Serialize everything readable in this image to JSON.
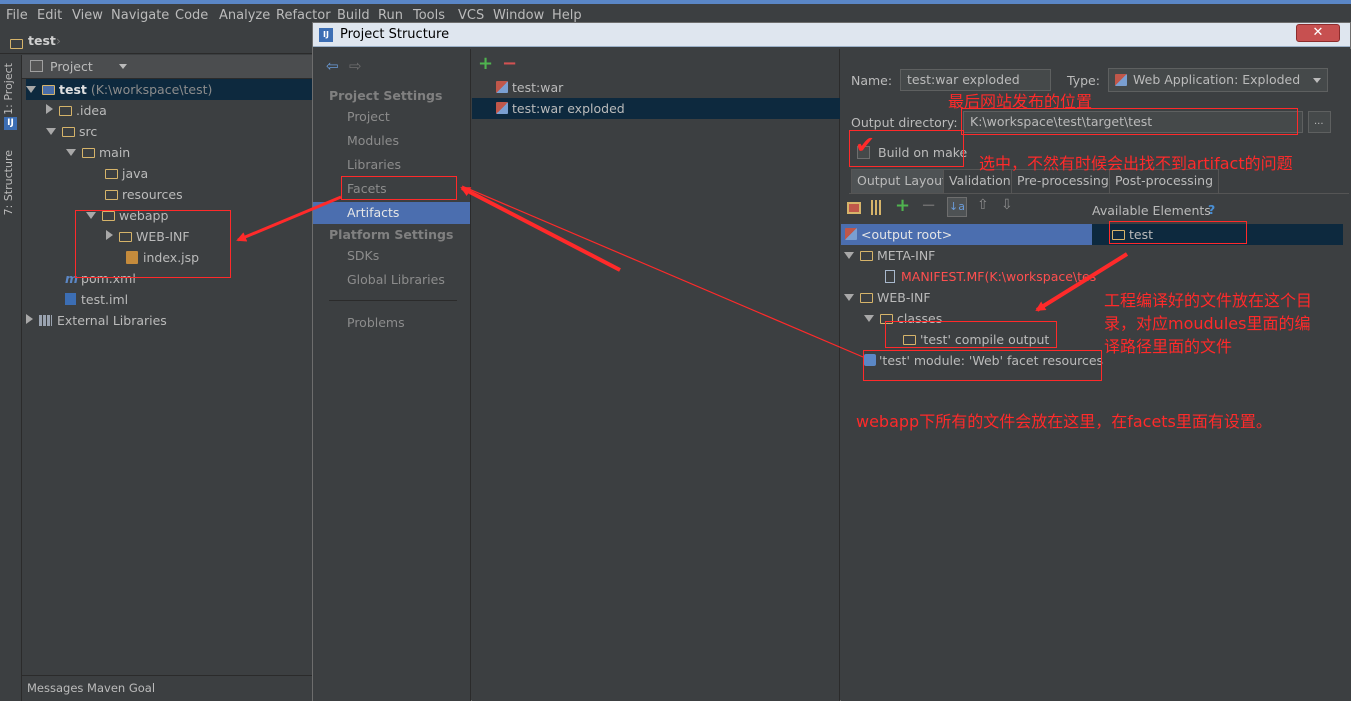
{
  "menubar": {
    "items": [
      "File",
      "Edit",
      "View",
      "Navigate",
      "Code",
      "Analyze",
      "Refactor",
      "Build",
      "Run",
      "Tools",
      "VCS",
      "Window",
      "Help"
    ]
  },
  "navbar": {
    "breadcrumb": "test"
  },
  "toolstrip": {
    "tab_project": "1: Project",
    "tab_structure": "7: Structure"
  },
  "project_panel": {
    "view_selector": "Project",
    "tree": [
      {
        "label": "test",
        "hint": "(K:\\workspace\\test)"
      },
      {
        "label": ".idea"
      },
      {
        "label": "src"
      },
      {
        "label": "main"
      },
      {
        "label": "java"
      },
      {
        "label": "resources"
      },
      {
        "label": "webapp"
      },
      {
        "label": "WEB-INF"
      },
      {
        "label": "index.jsp"
      },
      {
        "label": "pom.xml"
      },
      {
        "label": "test.iml"
      },
      {
        "label": "External Libraries"
      }
    ],
    "bottom_bar": "Messages Maven Goal"
  },
  "dialog": {
    "title": "Project Structure",
    "close": "✕",
    "nav": {
      "project_settings_heading": "Project Settings",
      "project_settings": [
        "Project",
        "Modules",
        "Libraries",
        "Facets",
        "Artifacts"
      ],
      "platform_settings_heading": "Platform Settings",
      "platform_settings": [
        "SDKs",
        "Global Libraries"
      ],
      "problems": "Problems",
      "selected": "Artifacts"
    },
    "artifacts": [
      "test:war",
      "test:war exploded"
    ],
    "selected_artifact": "test:war exploded",
    "detail": {
      "name_label": "Name:",
      "name_value": "test:war exploded",
      "type_label": "Type:",
      "type_value": "Web Application: Exploded",
      "output_dir_label": "Output directory:",
      "output_dir_value": "K:\\workspace\\test\\target\\test",
      "browse": "...",
      "build_on_make": "Build on make",
      "build_on_make_checked": true,
      "tabs": [
        "Output Layout",
        "Validation",
        "Pre-processing",
        "Post-processing"
      ],
      "selected_tab": "Output Layout",
      "available_elements_label": "Available Elements",
      "help": "?",
      "layout_tree": [
        "<output root>",
        "META-INF",
        "MANIFEST.MF(K:\\workspace\\tes",
        "WEB-INF",
        "classes",
        "'test' compile output",
        "'test' module: 'Web' facet resources"
      ],
      "available_tree": [
        "test"
      ]
    }
  },
  "annotations": {
    "output_location": "最后网站发布的位置",
    "build_on_make_note": "选中，不然有时候会出找不到artifact的问题",
    "compile_output_note_1": "工程编译好的文件放在这个目",
    "compile_output_note_2": "录，对应moudules里面的编",
    "compile_output_note_3": "译路径里面的文件",
    "webapp_note": "webapp下所有的文件会放在这里，在facets里面有设置。"
  },
  "colors": {
    "background": "#3c3f41",
    "selection": "#4b6eaf",
    "selection_dark": "#0d293e",
    "annotation_red": "#ff2a2a",
    "folder": "#d6b46a"
  }
}
